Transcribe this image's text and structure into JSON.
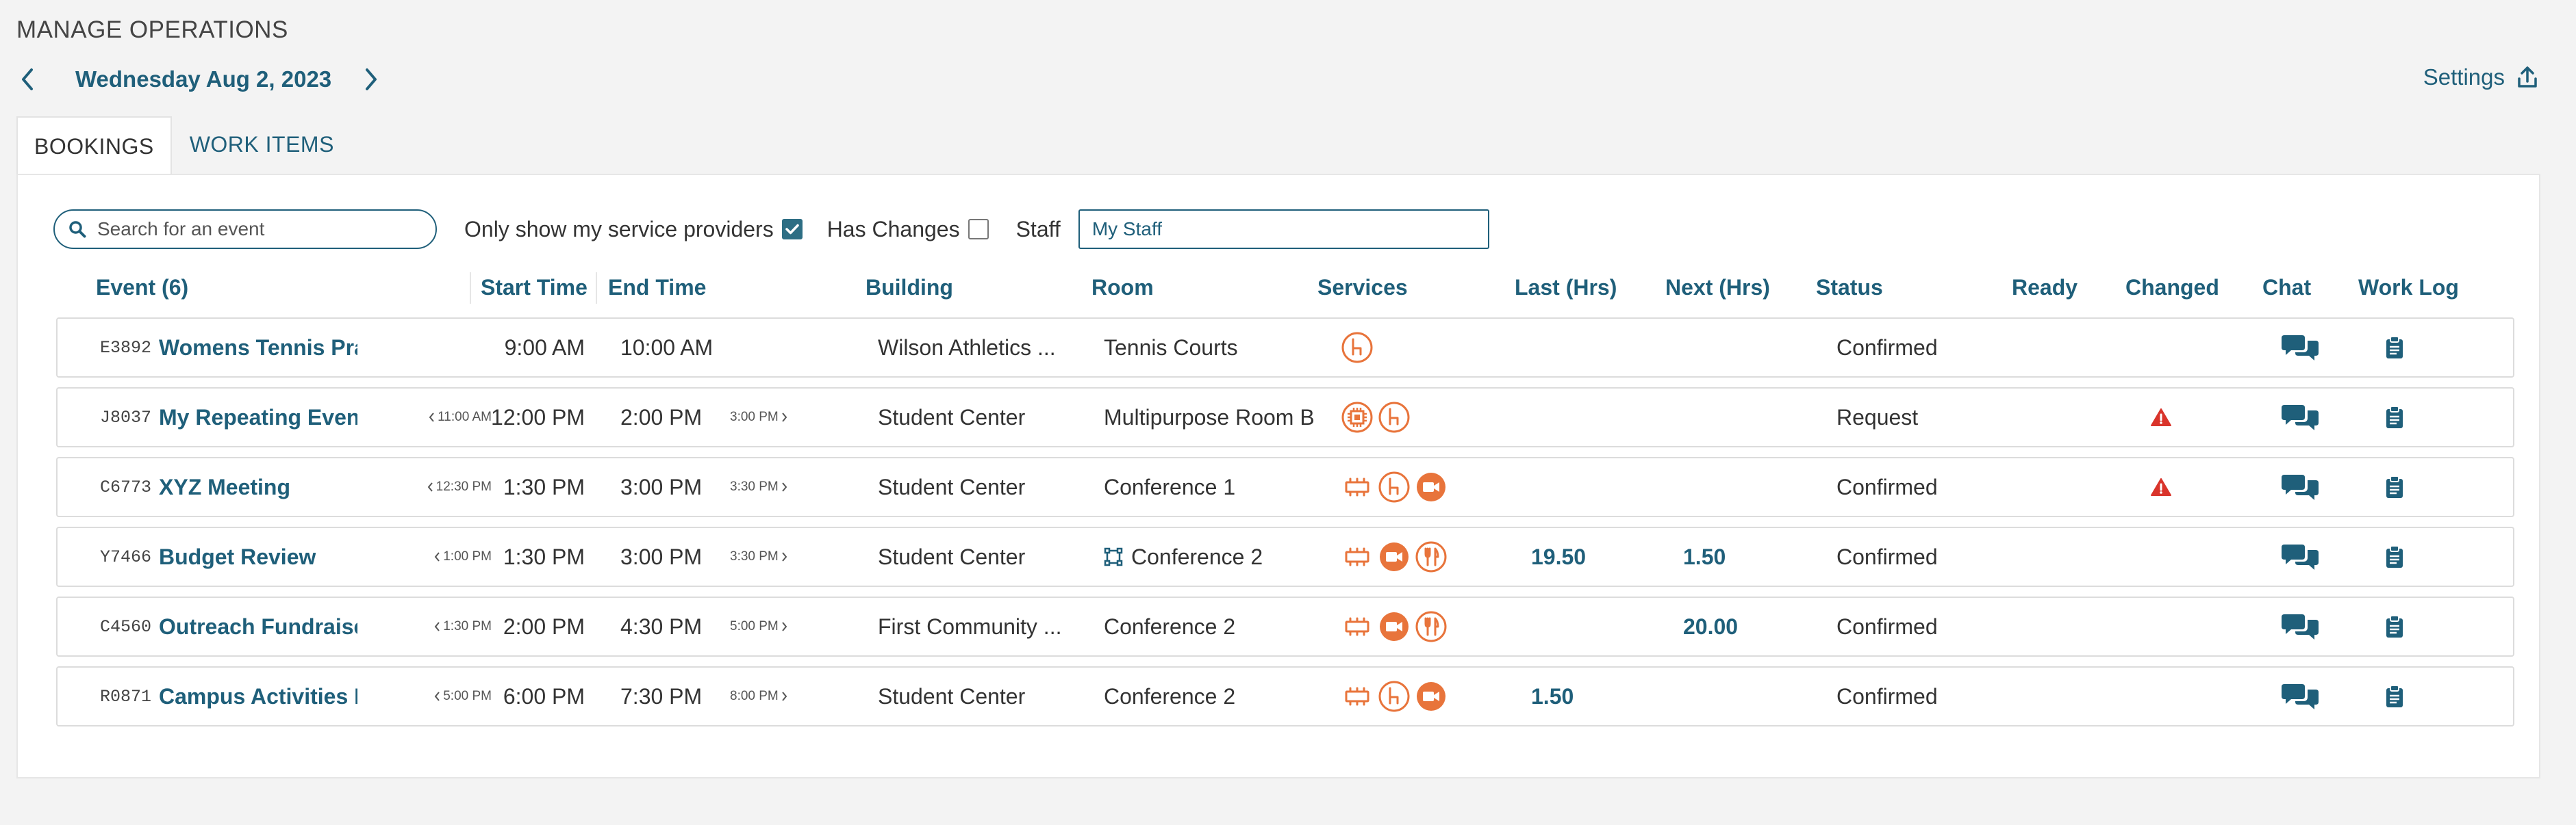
{
  "page": {
    "title": "MANAGE OPERATIONS",
    "date": "Wednesday Aug 2, 2023",
    "settings_label": "Settings"
  },
  "tabs": [
    {
      "label": "BOOKINGS",
      "active": true
    },
    {
      "label": "WORK ITEMS",
      "active": false
    }
  ],
  "filters": {
    "search_placeholder": "Search for an event",
    "only_my_providers_label": "Only show my service providers",
    "only_my_providers_checked": true,
    "has_changes_label": "Has Changes",
    "has_changes_checked": false,
    "staff_label": "Staff",
    "staff_value": "My Staff"
  },
  "columns": {
    "event": "Event (6)",
    "start": "Start Time",
    "end": "End Time",
    "building": "Building",
    "room": "Room",
    "services": "Services",
    "last": "Last (Hrs)",
    "next": "Next (Hrs)",
    "status": "Status",
    "ready": "Ready",
    "changed": "Changed",
    "chat": "Chat",
    "worklog": "Work Log"
  },
  "colors": {
    "accent": "#1f5f7a",
    "service_orange": "#e8743b",
    "warning_red": "#d9342b"
  },
  "rows": [
    {
      "code": "E3892",
      "name": "Womens Tennis Prac",
      "prev": "",
      "start": "9:00 AM",
      "end": "10:00 AM",
      "next": "",
      "building": "Wilson Athletics ...",
      "room": "Tennis Courts",
      "room_icon": false,
      "services": [
        "furniture-icon"
      ],
      "last_hrs": "",
      "next_hrs": "",
      "status": "Confirmed",
      "changed": false
    },
    {
      "code": "J8037",
      "name": "My Repeating Event",
      "prev": "11:00 AM",
      "start": "12:00 PM",
      "end": "2:00 PM",
      "next": "3:00 PM",
      "building": "Student Center",
      "room": "Multipurpose Room B",
      "room_icon": false,
      "services": [
        "equipment-icon",
        "furniture-icon"
      ],
      "last_hrs": "",
      "next_hrs": "",
      "status": "Request",
      "changed": true
    },
    {
      "code": "C6773",
      "name": "XYZ Meeting",
      "prev": "12:30 PM",
      "start": "1:30 PM",
      "end": "3:00 PM",
      "next": "3:30 PM",
      "building": "Student Center",
      "room": "Conference 1",
      "room_icon": false,
      "services": [
        "setup-icon",
        "furniture-icon",
        "video-icon"
      ],
      "last_hrs": "",
      "next_hrs": "",
      "status": "Confirmed",
      "changed": true
    },
    {
      "code": "Y7466",
      "name": "Budget Review",
      "prev": "1:00 PM",
      "start": "1:30 PM",
      "end": "3:00 PM",
      "next": "3:30 PM",
      "building": "Student Center",
      "room": "Conference 2",
      "room_icon": true,
      "services": [
        "setup-icon",
        "video-icon",
        "catering-icon"
      ],
      "last_hrs": "19.50",
      "next_hrs": "1.50",
      "status": "Confirmed",
      "changed": false
    },
    {
      "code": "C4560",
      "name": "Outreach Fundraiser",
      "prev": "1:30 PM",
      "start": "2:00 PM",
      "end": "4:30 PM",
      "next": "5:00 PM",
      "building": "First Community ...",
      "room": "Conference 2",
      "room_icon": false,
      "services": [
        "setup-icon",
        "video-icon",
        "catering-icon"
      ],
      "last_hrs": "",
      "next_hrs": "20.00",
      "status": "Confirmed",
      "changed": false
    },
    {
      "code": "R0871",
      "name": "Campus Activities M",
      "prev": "5:00 PM",
      "start": "6:00 PM",
      "end": "7:30 PM",
      "next": "8:00 PM",
      "building": "Student Center",
      "room": "Conference 2",
      "room_icon": false,
      "services": [
        "setup-icon",
        "furniture-icon",
        "video-icon"
      ],
      "last_hrs": "1.50",
      "next_hrs": "",
      "status": "Confirmed",
      "changed": false
    }
  ]
}
